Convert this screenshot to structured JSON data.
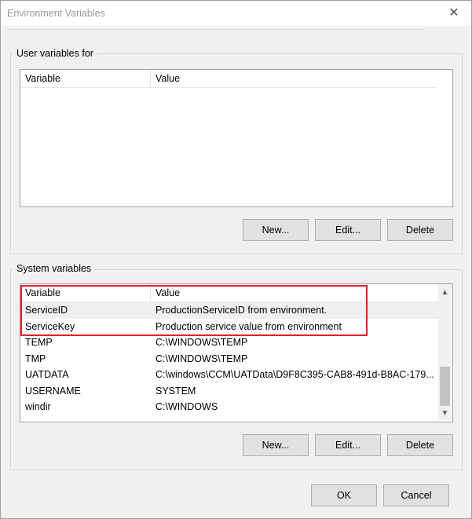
{
  "window": {
    "title": "Environment Variables"
  },
  "user_vars": {
    "group_label": "User variables for",
    "columns": [
      "Variable",
      "Value"
    ],
    "rows": [],
    "buttons": {
      "new": "New...",
      "edit": "Edit...",
      "delete": "Delete"
    }
  },
  "system_vars": {
    "group_label": "System variables",
    "columns": [
      "Variable",
      "Value"
    ],
    "rows": [
      {
        "variable": "ServiceID",
        "value": "ProductionServiceID from environment."
      },
      {
        "variable": "ServiceKey",
        "value": "Production service value from environment"
      },
      {
        "variable": "TEMP",
        "value": "C:\\WINDOWS\\TEMP"
      },
      {
        "variable": "TMP",
        "value": "C:\\WINDOWS\\TEMP"
      },
      {
        "variable": "UATDATA",
        "value": "C:\\windows\\CCM\\UATData\\D9F8C395-CAB8-491d-B8AC-179..."
      },
      {
        "variable": "USERNAME",
        "value": "SYSTEM"
      },
      {
        "variable": "windir",
        "value": "C:\\WINDOWS"
      }
    ],
    "buttons": {
      "new": "New...",
      "edit": "Edit...",
      "delete": "Delete"
    }
  },
  "footer": {
    "ok": "OK",
    "cancel": "Cancel"
  },
  "colors": {
    "highlight_border": "#e21f2a",
    "scroll_thumb": "#c2c2c2"
  },
  "icons": {
    "close": "close-icon",
    "scroll_up": "chevron-up-icon",
    "scroll_down": "chevron-down-icon"
  }
}
